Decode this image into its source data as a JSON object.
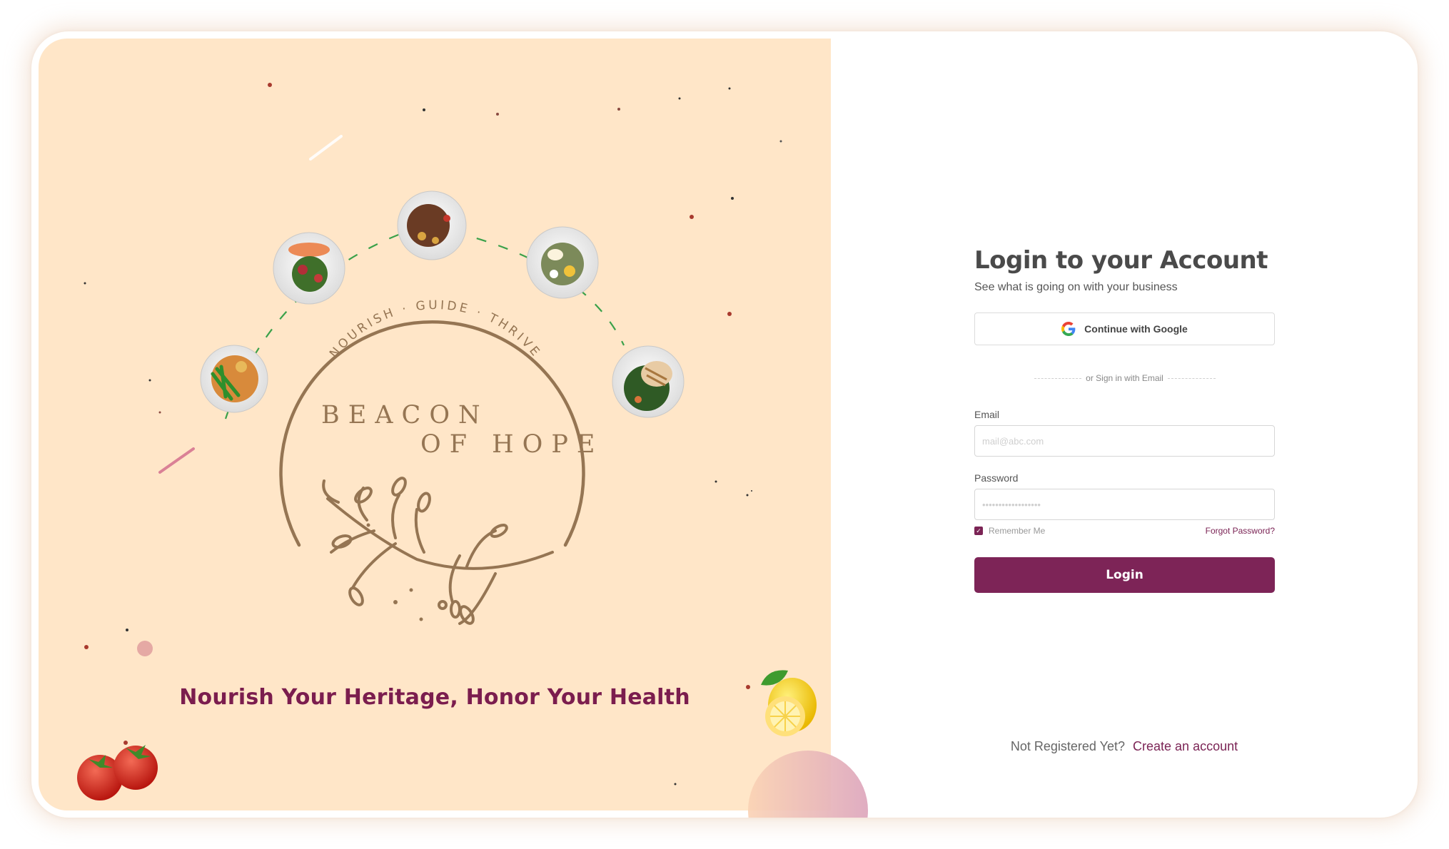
{
  "brand": {
    "arc_text": "NOURISH · GUIDE · THRIVE",
    "name_line1": "BEACON",
    "name_line2": "OF HOPE",
    "tagline": "Nourish Your Heritage, Honor Your Health"
  },
  "colors": {
    "panel_bg": "#ffe6c8",
    "brand_brown": "#957553",
    "accent": "#7d2457",
    "tagline": "#7b1d4e"
  },
  "illustrations": [
    "food-plate-rice-beans",
    "food-plate-salmon-salad",
    "food-plate-steak",
    "food-plate-egg-salad",
    "food-plate-grilled-chicken",
    "tomato-image",
    "lemon-image",
    "olive-branch-icon"
  ],
  "login": {
    "title": "Login to your Account",
    "subtitle": "See what is going on with your business",
    "google_button": "Continue with Google",
    "google_icon": "google-logo-icon",
    "divider_text": "or Sign in with Email",
    "email_label": "Email",
    "email_placeholder": "mail@abc.com",
    "password_label": "Password",
    "password_placeholder": "••••••••••••••••••",
    "remember_label": "Remember Me",
    "remember_checked": true,
    "forgot_link": "Forgot Password?",
    "login_button": "Login",
    "register_prompt": "Not Registered Yet?",
    "register_link": "Create an account"
  }
}
